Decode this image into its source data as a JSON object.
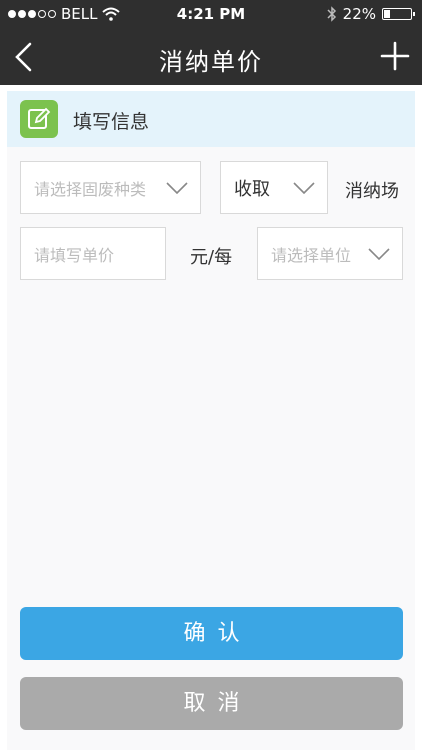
{
  "status_bar": {
    "carrier": "BELL",
    "time": "4:21 PM",
    "battery_percent": "22%",
    "battery_level": 0.22,
    "signal_strength_of_5": 3
  },
  "nav": {
    "title": "消纳单价",
    "back_icon": "chevron-left-icon",
    "add_icon": "plus-icon"
  },
  "section": {
    "label": "填写信息",
    "icon": "edit-icon",
    "icon_color": "#7cc24e"
  },
  "form": {
    "waste_type_placeholder": "请选择固废种类",
    "direction_value": "收取",
    "site_label": "消纳场",
    "price_placeholder": "请填写单价",
    "unit_prefix": "元/每",
    "unit_placeholder": "请选择单位"
  },
  "buttons": {
    "confirm": "确认",
    "cancel": "取消",
    "confirm_color": "#3ba6e4",
    "cancel_color": "#aaaaaa"
  }
}
